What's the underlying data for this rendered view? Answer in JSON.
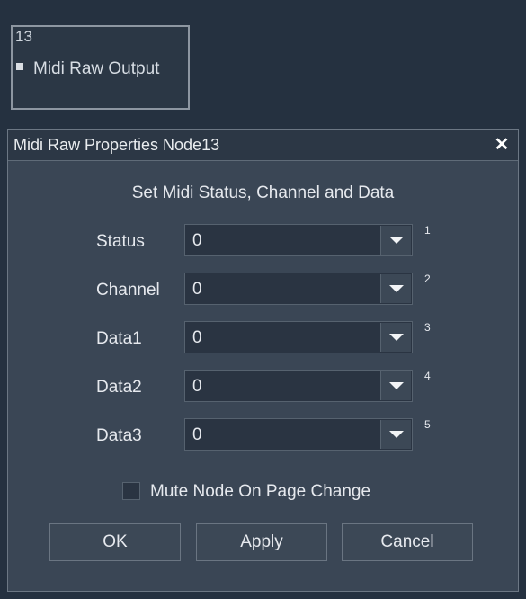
{
  "node": {
    "id": "13",
    "label": "Midi Raw Output"
  },
  "dialog": {
    "title": "Midi Raw Properties Node13",
    "close_label": "✕",
    "heading": "Set Midi Status, Channel and Data",
    "rows": [
      {
        "label": "Status",
        "value": "0",
        "index": "1"
      },
      {
        "label": "Channel",
        "value": "0",
        "index": "2"
      },
      {
        "label": "Data1",
        "value": "0",
        "index": "3"
      },
      {
        "label": "Data2",
        "value": "0",
        "index": "4"
      },
      {
        "label": "Data3",
        "value": "0",
        "index": "5"
      }
    ],
    "checkbox": {
      "label": "Mute Node On Page Change",
      "checked": false
    },
    "buttons": {
      "ok": "OK",
      "apply": "Apply",
      "cancel": "Cancel"
    }
  },
  "icons": {
    "close": "close-icon",
    "dropdown": "chevron-down-icon",
    "port": "port-icon"
  }
}
